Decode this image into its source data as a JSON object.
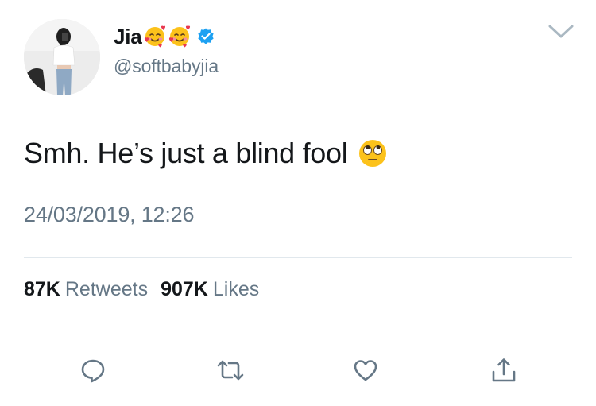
{
  "user": {
    "display_name": "Jia",
    "name_emoji": [
      "smiling-face-with-hearts-icon",
      "smiling-face-with-hearts-icon"
    ],
    "verified": true,
    "handle": "@softbabyjia"
  },
  "tweet": {
    "text": "Smh. He’s just a blind fool",
    "text_emoji": "face-with-rolling-eyes-icon",
    "timestamp": "24/03/2019, 12:26"
  },
  "stats": {
    "retweets_count": "87K",
    "retweets_label": "Retweets",
    "likes_count": "907K",
    "likes_label": "Likes"
  },
  "actions": [
    "reply-icon",
    "retweet-icon",
    "like-icon",
    "share-icon"
  ],
  "colors": {
    "text_primary": "#14171a",
    "text_secondary": "#657786",
    "divider": "#e1e8ed",
    "verified_blue": "#1da1f2",
    "icon_gray": "#657786"
  }
}
